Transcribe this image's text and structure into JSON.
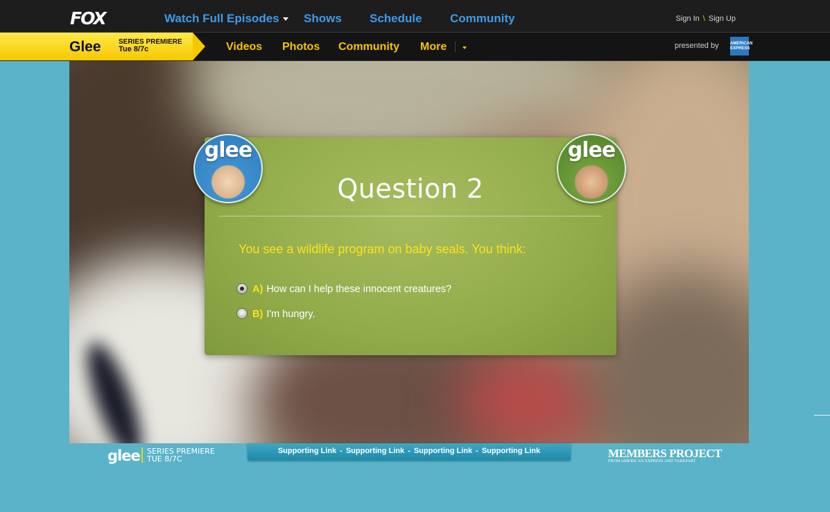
{
  "top_nav": {
    "logo": "FOX",
    "links": [
      "Watch Full Episodes",
      "Shows",
      "Schedule",
      "Community"
    ],
    "sign_in": "Sign In",
    "separator": "\\",
    "sign_up": "Sign Up"
  },
  "show_nav": {
    "show_name": "Glee",
    "premiere_label": "SERIES PREMIERE",
    "premiere_date": "Tue 8/7c",
    "links": [
      "Videos",
      "Photos",
      "Community",
      "More"
    ],
    "presented_by": "presented by",
    "sponsor_logo": "AMERICAN EXPRESS"
  },
  "quiz": {
    "title": "Question 2",
    "question": "You see a wildlife program on baby seals. You think:",
    "answers": [
      {
        "letter": "A)",
        "text": "How can I help these innocent creatures?",
        "selected": true
      },
      {
        "letter": "B)",
        "text": "I'm hungry.",
        "selected": false
      }
    ],
    "avatar_logo": "glee"
  },
  "footer": {
    "glee_logo": "glee",
    "premiere_label": "SERIES PREMIERE",
    "premiere_date": "TUE 8/7C",
    "support_links": [
      "Supporting Link",
      "Supporting Link",
      "Supporting Link",
      "Supporting Link"
    ],
    "members_title": "MEMBERS PROJECT",
    "members_sub": "FROM AMERICAN EXPRESS AND TAKEPART"
  },
  "colors": {
    "background": "#5ab3c9",
    "nav_blue": "#3d9be6",
    "glee_yellow": "#f5c400",
    "quiz_green": "#94ad4c"
  }
}
